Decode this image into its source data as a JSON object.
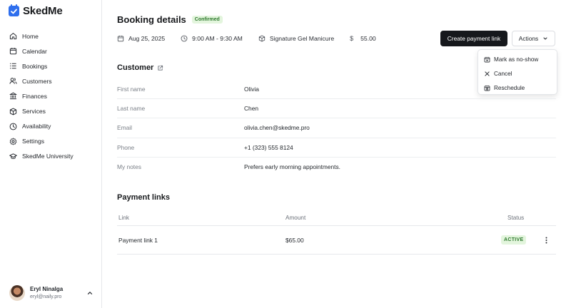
{
  "brand": {
    "name": "SkedMe",
    "color": "#2f6fed"
  },
  "sidebar": {
    "items": [
      {
        "label": "Home",
        "icon": "home-icon"
      },
      {
        "label": "Calendar",
        "icon": "calendar-icon"
      },
      {
        "label": "Bookings",
        "icon": "list-icon"
      },
      {
        "label": "Customers",
        "icon": "users-icon"
      },
      {
        "label": "Finances",
        "icon": "bank-icon"
      },
      {
        "label": "Services",
        "icon": "box-icon"
      },
      {
        "label": "Availability",
        "icon": "clock-icon"
      },
      {
        "label": "Settings",
        "icon": "gear-icon"
      },
      {
        "label": "SkedMe University",
        "icon": "graduation-cap-icon"
      }
    ]
  },
  "user": {
    "name": "Eryl Ninalga",
    "email": "eryl@naily.pro"
  },
  "header": {
    "title": "Booking details",
    "status_badge": "Confirmed",
    "date": "Aug 25, 2025",
    "time": "9:00 AM - 9:30 AM",
    "service": "Signature Gel Manicure",
    "currency_symbol": "$",
    "price": "55.00",
    "create_payment_link_label": "Create payment link",
    "actions_label": "Actions"
  },
  "actions_menu": {
    "items": [
      {
        "label": "Mark as no-show",
        "icon": "calendar-x-icon"
      },
      {
        "label": "Cancel",
        "icon": "close-icon"
      },
      {
        "label": "Reschedule",
        "icon": "calendar-clock-icon"
      }
    ]
  },
  "customer": {
    "title": "Customer",
    "fields": [
      {
        "key": "First name",
        "value": "Olivia"
      },
      {
        "key": "Last name",
        "value": "Chen"
      },
      {
        "key": "Email",
        "value": "olivia.chen@skedme.pro"
      },
      {
        "key": "Phone",
        "value": "+1 (323) 555 8124"
      },
      {
        "key": "My notes",
        "value": "Prefers early morning appointments."
      }
    ]
  },
  "payment_links": {
    "title": "Payment links",
    "columns": {
      "link": "Link",
      "amount": "Amount",
      "status": "Status"
    },
    "rows": [
      {
        "link": "Payment link 1",
        "amount": "$65.00",
        "status": "ACTIVE"
      }
    ]
  },
  "colors": {
    "accent": "#2f6fed",
    "primary_button": "#16181c",
    "success_bg": "#e3f5dd",
    "success_text": "#2f7a2f"
  }
}
